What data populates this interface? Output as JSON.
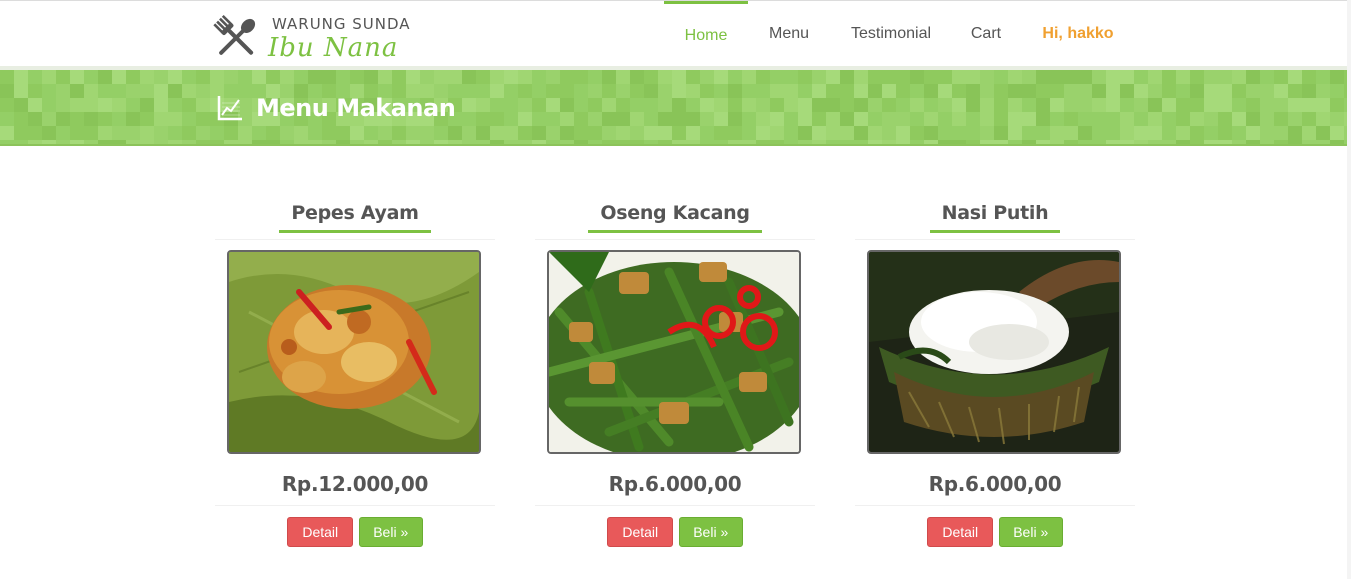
{
  "brand": {
    "line1": "WARUNG SUNDA",
    "line2": "Ibu Nana"
  },
  "nav": {
    "items": [
      {
        "label": "Home",
        "active": true
      },
      {
        "label": "Menu",
        "active": false
      },
      {
        "label": "Testimonial",
        "active": false
      },
      {
        "label": "Cart",
        "active": false
      }
    ],
    "user_greeting": "Hi, hakko"
  },
  "banner": {
    "title": "Menu Makanan",
    "icon": "line-chart-icon"
  },
  "products": [
    {
      "name": "Pepes Ayam",
      "price": "Rp.12.000,00",
      "detail_label": "Detail",
      "buy_label": "Beli »"
    },
    {
      "name": "Oseng Kacang",
      "price": "Rp.6.000,00",
      "detail_label": "Detail",
      "buy_label": "Beli »"
    },
    {
      "name": "Nasi Putih",
      "price": "Rp.6.000,00",
      "detail_label": "Detail",
      "buy_label": "Beli »"
    }
  ],
  "colors": {
    "accent_green": "#7dc142",
    "banner_green": "#9ad26c",
    "user_orange": "#f0a030",
    "detail_red": "#e8595a"
  }
}
